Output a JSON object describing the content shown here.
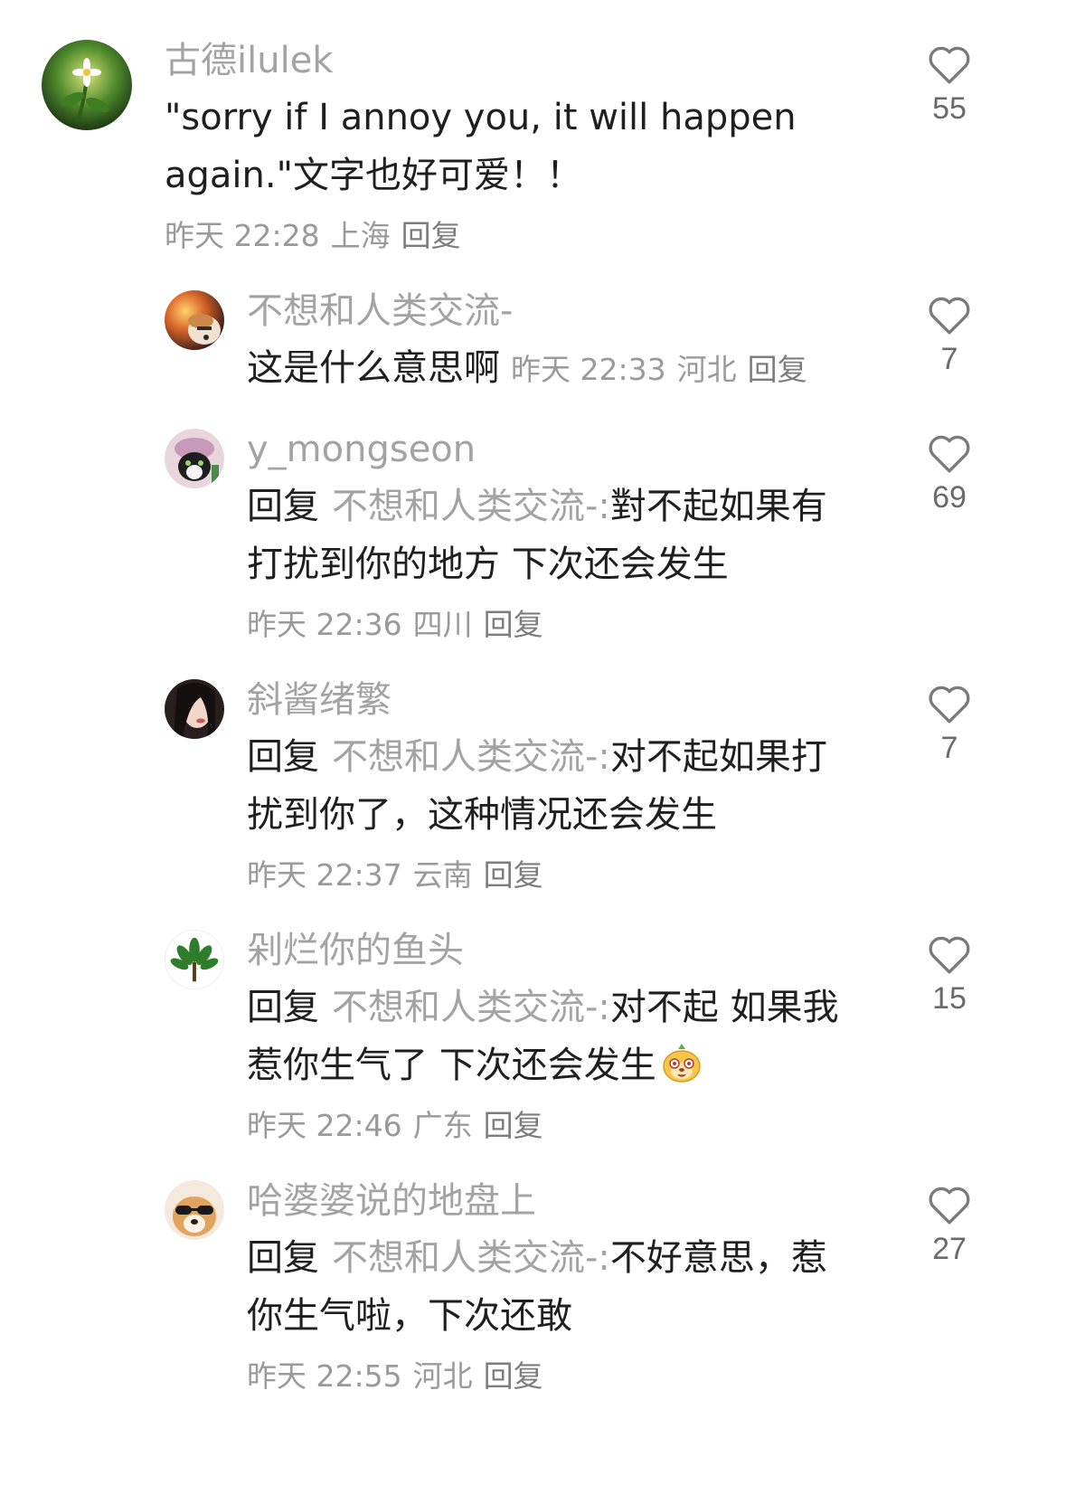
{
  "comments": [
    {
      "username": "古德ilulek",
      "text_lines": [
        "\"sorry if I annoy you, it will happen",
        "again.\"文字也好可爱！！"
      ],
      "time": "昨天 22:28",
      "location": "上海",
      "reply_label": "回复",
      "likes": "55",
      "avatar": "flower-avatar"
    },
    {
      "username": "不想和人类交流-",
      "text": "这是什么意思啊",
      "time": "昨天 22:33",
      "location": "河北",
      "reply_label": "回复",
      "likes": "7",
      "avatar": "dog-sunset-avatar"
    },
    {
      "username": "y_mongseon",
      "reply_prefix": "回复",
      "reply_target": "不想和人类交流-:",
      "text_line1": "對不起如果有",
      "text_line2": "打扰到你的地方 下次还会发生",
      "time": "昨天 22:36",
      "location": "四川",
      "reply_label": "回复",
      "likes": "69",
      "avatar": "cat-avatar"
    },
    {
      "username": "斜酱绪繁",
      "reply_prefix": "回复",
      "reply_target": "不想和人类交流-:",
      "text_line1": "对不起如果打",
      "text_line2": "扰到你了，这种情况还会发生",
      "time": "昨天 22:37",
      "location": "云南",
      "reply_label": "回复",
      "likes": "7",
      "avatar": "girl-avatar"
    },
    {
      "username": "剁烂你的鱼头",
      "reply_prefix": "回复",
      "reply_target": "不想和人类交流-:",
      "text_line1": "对不起 如果我",
      "text_line2": "惹你生气了 下次还会发生",
      "time": "昨天 22:46",
      "location": "广东",
      "reply_label": "回复",
      "likes": "15",
      "avatar": "plant-avatar",
      "emoji": "cheeky-face-emoji"
    },
    {
      "username": "哈婆婆说的地盘上",
      "reply_prefix": "回复",
      "reply_target": "不想和人类交流-:",
      "text_line1": "不好意思，惹",
      "text_line2": "你生气啦，下次还敢",
      "time": "昨天 22:55",
      "location": "河北",
      "reply_label": "回复",
      "likes": "27",
      "avatar": "dog-sunglasses-avatar"
    }
  ],
  "icons": {
    "like": "heart-outline-icon"
  },
  "colors": {
    "username": "#a3a3a3",
    "text": "#1f1f1f",
    "meta": "#9a9a9a",
    "like_count": "#6a6a6a"
  }
}
